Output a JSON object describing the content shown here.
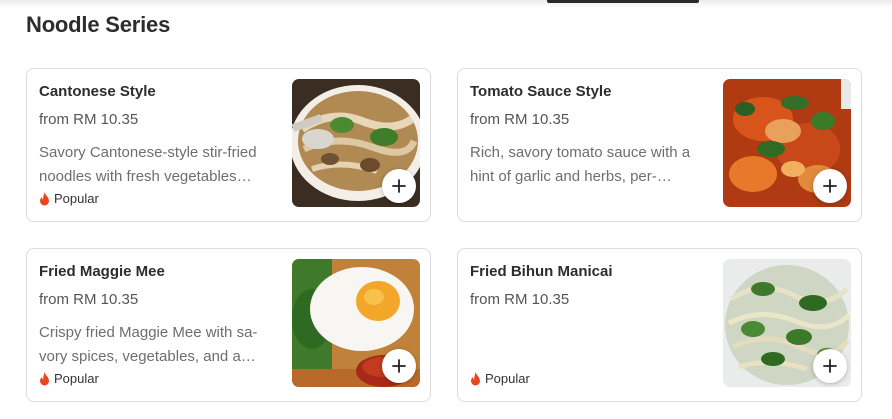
{
  "section": {
    "title": "Noodle Series"
  },
  "items": [
    {
      "name": "Cantonese Style",
      "price": "from RM 10.35",
      "description": "Savory Cantonese-style stir-fried noodles with fresh vegetables…",
      "badge": "Popular"
    },
    {
      "name": "Tomato Sauce Style",
      "price": "from RM 10.35",
      "description": "Rich, savory tomato sauce with a hint of garlic and herbs, per-…",
      "badge": ""
    },
    {
      "name": "Fried Maggie Mee",
      "price": "from RM 10.35",
      "description": "Crispy fried Maggie Mee with sa-vory spices, vegetables, and a…",
      "badge": "Popular"
    },
    {
      "name": "Fried Bihun Manicai",
      "price": "from RM 10.35",
      "description": "",
      "badge": "Popular"
    }
  ],
  "icons": {
    "add": "plus-icon",
    "popular": "fire-icon"
  },
  "colors": {
    "flame": "#e8471d",
    "text": "#2d2d2d",
    "muted": "#6e6e6e",
    "border": "#dcdcdc"
  }
}
